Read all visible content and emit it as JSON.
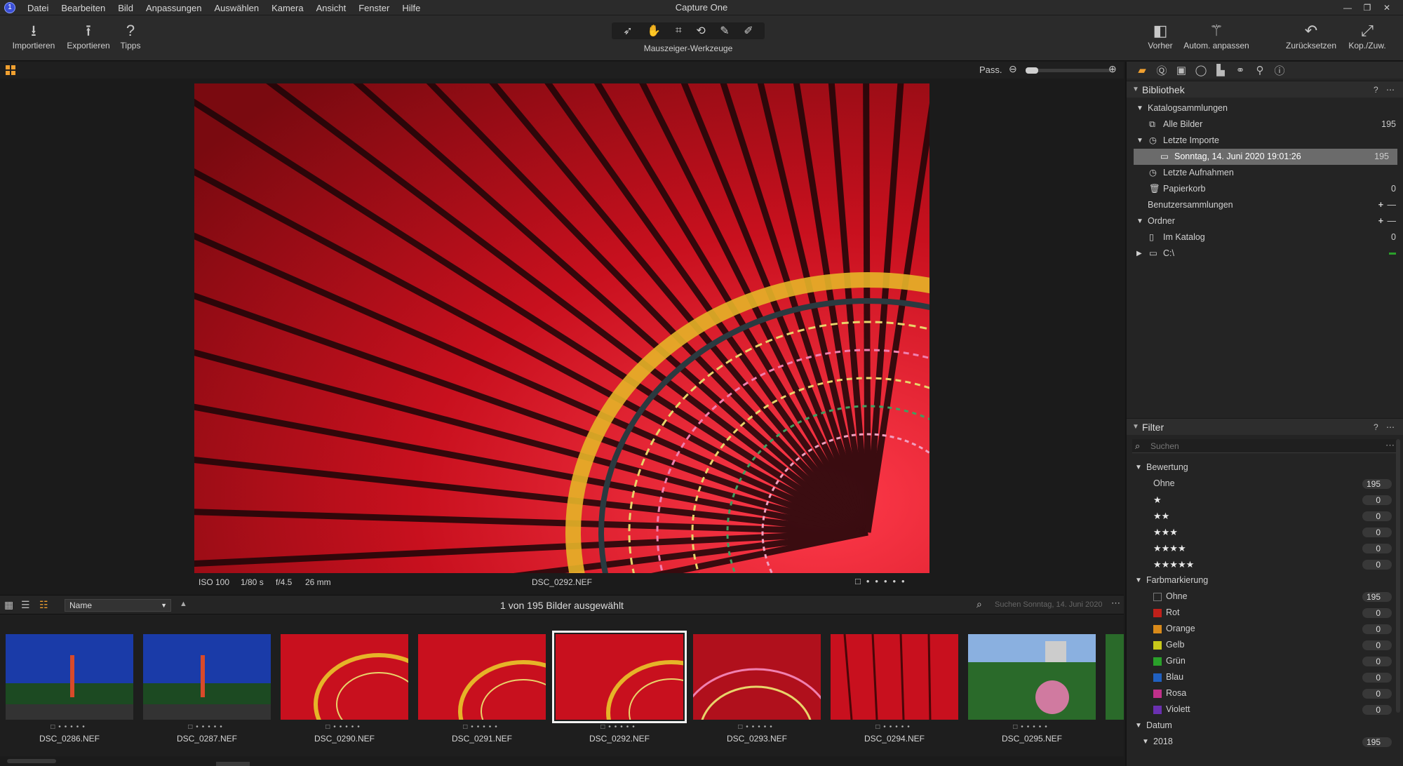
{
  "app": {
    "title": "Capture One"
  },
  "menu": [
    "Datei",
    "Bearbeiten",
    "Bild",
    "Anpassungen",
    "Auswählen",
    "Kamera",
    "Ansicht",
    "Fenster",
    "Hilfe"
  ],
  "toolbar": {
    "import": "Importieren",
    "export": "Exportieren",
    "tips": "Tipps",
    "cursor_tools": "Mauszeiger-Werkzeuge",
    "before": "Vorher",
    "auto_adjust": "Autom. anpassen",
    "reset": "Zurücksetzen",
    "copy_apply": "Kop./Zuw."
  },
  "viewer": {
    "fit_label": "Pass.",
    "meta": {
      "iso": "ISO 100",
      "shutter": "1/80 s",
      "aperture": "f/4.5",
      "focal": "26 mm",
      "filename": "DSC_0292.NEF"
    }
  },
  "browser": {
    "sort": "Name",
    "selection_status": "1 von 195 Bilder ausgewählt",
    "search_placeholder": "Suchen Sonntag, 14. Juni 2020",
    "thumbnails": [
      "DSC_0286.NEF",
      "DSC_0287.NEF",
      "DSC_0290.NEF",
      "DSC_0291.NEF",
      "DSC_0292.NEF",
      "DSC_0293.NEF",
      "DSC_0294.NEF",
      "DSC_0295.NEF"
    ]
  },
  "library": {
    "title": "Bibliothek",
    "catalog_collections": "Katalogsammlungen",
    "all_images": "Alle Bilder",
    "all_images_count": "195",
    "recent_imports": "Letzte Importe",
    "import_entry": "Sonntag, 14. Juni 2020 19:01:26",
    "import_entry_count": "195",
    "recent_captures": "Letzte Aufnahmen",
    "trash": "Papierkorb",
    "trash_count": "0",
    "user_collections": "Benutzersammlungen",
    "folders": "Ordner",
    "in_catalog": "Im Katalog",
    "in_catalog_count": "0",
    "drive": "C:\\"
  },
  "filter": {
    "title": "Filter",
    "search_placeholder": "Suchen",
    "rating_header": "Bewertung",
    "ratings": [
      {
        "label": "Ohne",
        "count": "195"
      },
      {
        "stars": "★",
        "count": "0"
      },
      {
        "stars": "★★",
        "count": "0"
      },
      {
        "stars": "★★★",
        "count": "0"
      },
      {
        "stars": "★★★★",
        "count": "0"
      },
      {
        "stars": "★★★★★",
        "count": "0"
      }
    ],
    "color_header": "Farbmarkierung",
    "colors": [
      {
        "label": "Ohne",
        "count": "195",
        "color": "#2a2a2a"
      },
      {
        "label": "Rot",
        "count": "0",
        "color": "#c0201a"
      },
      {
        "label": "Orange",
        "count": "0",
        "color": "#d98a1a"
      },
      {
        "label": "Gelb",
        "count": "0",
        "color": "#c8c81a"
      },
      {
        "label": "Grün",
        "count": "0",
        "color": "#2aa02a"
      },
      {
        "label": "Blau",
        "count": "0",
        "color": "#2060c0"
      },
      {
        "label": "Rosa",
        "count": "0",
        "color": "#c0308a"
      },
      {
        "label": "Violett",
        "count": "0",
        "color": "#6a30b0"
      }
    ],
    "date_header": "Datum",
    "year": "2018",
    "year_count": "195"
  },
  "colors": {
    "accent": "#f0a030",
    "background": "#1b1b1b",
    "panel": "#242424"
  }
}
